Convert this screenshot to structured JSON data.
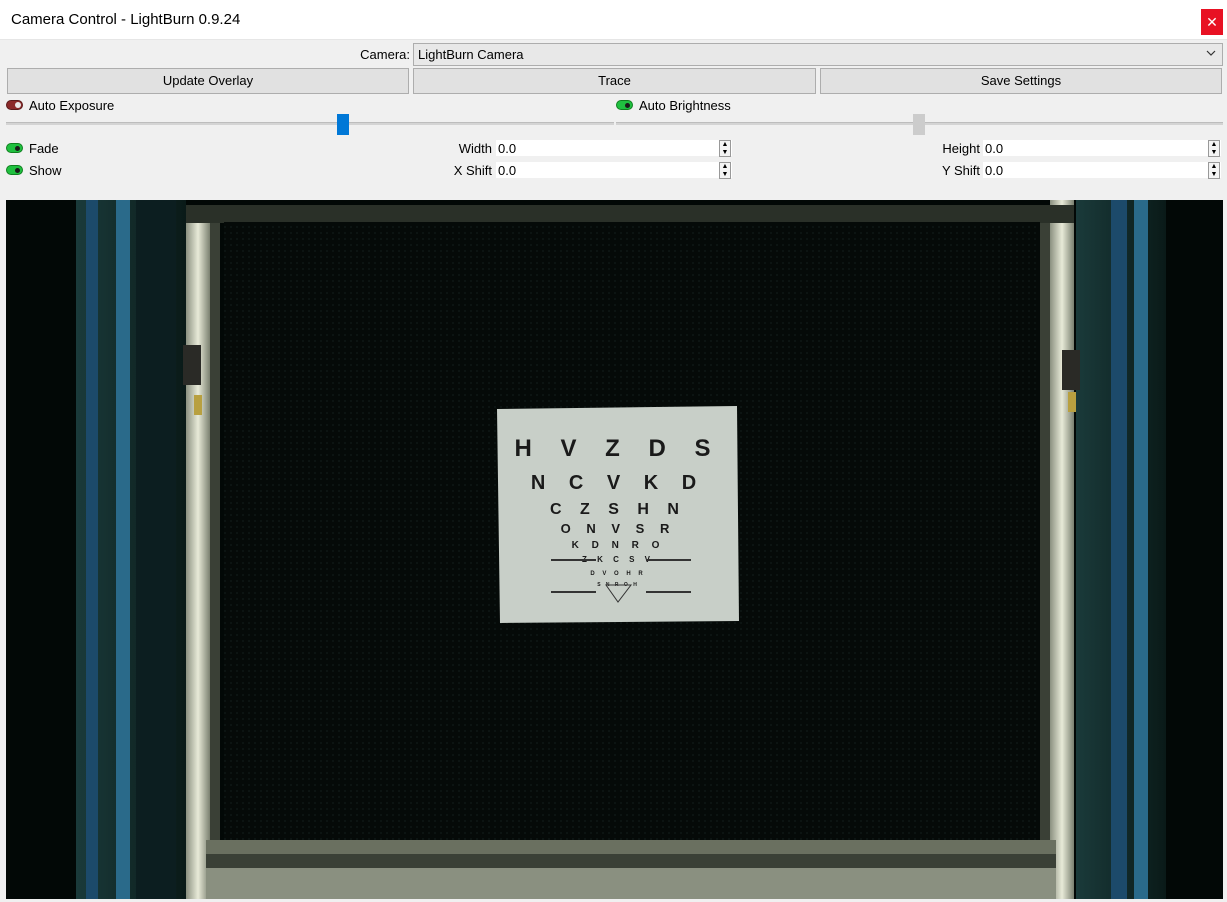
{
  "window": {
    "title": "Camera Control - LightBurn 0.9.24",
    "close_glyph": "✕"
  },
  "camera": {
    "label": "Camera:",
    "selected": "LightBurn Camera"
  },
  "buttons": {
    "update_overlay": "Update Overlay",
    "trace": "Trace",
    "save_settings": "Save Settings"
  },
  "auto_exposure": {
    "label": "Auto Exposure",
    "enabled": false,
    "slider_level": 0.55
  },
  "auto_brightness": {
    "label": "Auto Brightness",
    "enabled": true,
    "slider_level": 0.5
  },
  "fade": {
    "label": "Fade",
    "enabled": true
  },
  "show": {
    "label": "Show",
    "enabled": true
  },
  "fields": {
    "width": {
      "label": "Width",
      "value": "0.0"
    },
    "height": {
      "label": "Height",
      "value": "0.0"
    },
    "x_shift": {
      "label": "X Shift",
      "value": "0.0"
    },
    "y_shift": {
      "label": "Y Shift",
      "value": "0.0"
    }
  },
  "eye_chart": {
    "rows": [
      "HVZDS",
      "NCVKD",
      "CZSHN",
      "ONVSR",
      "KDNRO",
      "ZKCSV",
      "DVOHR",
      "SNROH"
    ]
  },
  "colors": {
    "toggle_on": "#20c040",
    "toggle_off": "#8b2a2a",
    "slider_active": "#0078d7",
    "close_button": "#e81123"
  }
}
